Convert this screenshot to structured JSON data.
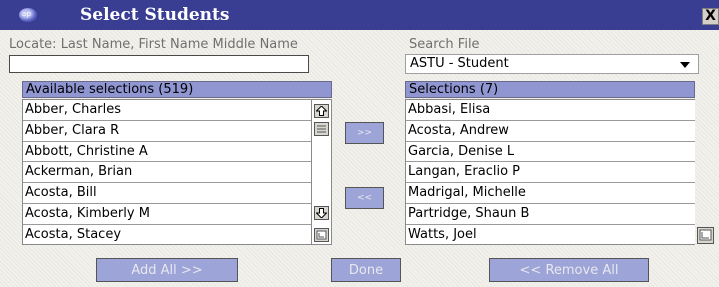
{
  "window": {
    "title": "Select Students",
    "app_icon_text": "a·p",
    "close_glyph": "X"
  },
  "locate": {
    "label": "Locate: Last Name, First Name Middle Name",
    "value": "",
    "placeholder": ""
  },
  "search_file": {
    "label": "Search File",
    "selected": "ASTU - Student"
  },
  "available": {
    "header": "Available selections (519)",
    "items": [
      "Abber, Charles",
      "Abber, Clara R",
      "Abbott, Christine A",
      "Ackerman, Brian",
      "Acosta, Bill",
      "Acosta, Kimberly M",
      "Acosta, Stacey"
    ]
  },
  "selections": {
    "header": "Selections (7)",
    "items": [
      "Abbasi, Elisa",
      "Acosta, Andrew",
      "Garcia, Denise L",
      "Langan, Eraclio P",
      "Madrigal, Michelle",
      "Partridge, Shaun B",
      "Watts, Joel"
    ]
  },
  "buttons": {
    "move_right": ">>",
    "move_left": "<<",
    "add_all": "Add All >>",
    "done": "Done",
    "remove_all": "<< Remove All"
  },
  "icons": {
    "app": "app-logo-icon",
    "close": "close-icon",
    "dropdown": "chevron-down-icon",
    "scroll_up": "arrow-up-icon",
    "scroll_down": "arrow-down-icon",
    "resize": "resize-corner-icon"
  },
  "colors": {
    "title_bar": "#3a3e93",
    "list_header": "#8f96d2",
    "button": "#9ca4d8"
  }
}
